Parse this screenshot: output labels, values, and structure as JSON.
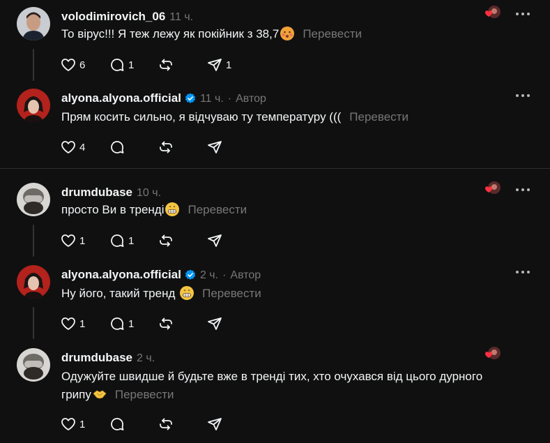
{
  "posts": [
    {
      "username": "volodimirovich_06",
      "time": "11 ч.",
      "text": "То вірус!!! Я теж лежу як покійник з 38,7",
      "translate": "Перевести",
      "likes": "6",
      "replies": "1",
      "reposts": "",
      "shares": "1",
      "author_badge": "",
      "verified": false,
      "liked_by_author": true,
      "emoji": "hot-face"
    },
    {
      "username": "alyona.alyona.official",
      "time": "11 ч.",
      "author_badge": "Автор",
      "text": "Прям косить сильно, я відчуваю ту температуру (((",
      "translate": "Перевести",
      "likes": "4",
      "replies": "",
      "reposts": "",
      "shares": "",
      "verified": true,
      "liked_by_author": false
    },
    {
      "username": "drumdubase",
      "time": "10 ч.",
      "text": "просто Ви в тренді",
      "translate": "Перевести",
      "likes": "1",
      "replies": "1",
      "reposts": "",
      "shares": "",
      "author_badge": "",
      "verified": false,
      "liked_by_author": true,
      "emoji": "grimacing"
    },
    {
      "username": "alyona.alyona.official",
      "time": "2 ч.",
      "author_badge": "Автор",
      "text": "Ну його, такий тренд",
      "translate": "Перевести",
      "likes": "1",
      "replies": "1",
      "reposts": "",
      "shares": "",
      "verified": true,
      "liked_by_author": false,
      "emoji": "grimacing"
    },
    {
      "username": "drumdubase",
      "time": "2 ч.",
      "text_line1": "Одужуйте швидше й будьте вже в тренді тих, хто очухався від цього дурного",
      "text_line2": "грипу",
      "translate": "Перевести",
      "likes": "1",
      "replies": "",
      "reposts": "",
      "shares": "",
      "author_badge": "",
      "verified": false,
      "liked_by_author": true,
      "emoji": "handshake"
    }
  ],
  "icons": [
    "heart-icon",
    "comment-icon",
    "repost-icon",
    "share-icon",
    "more-icon",
    "verified-icon"
  ],
  "colors": {
    "background": "#101010",
    "text": "#f3f5f7",
    "muted": "#777777",
    "verified": "#0095f6",
    "heart": "#ff3040"
  }
}
